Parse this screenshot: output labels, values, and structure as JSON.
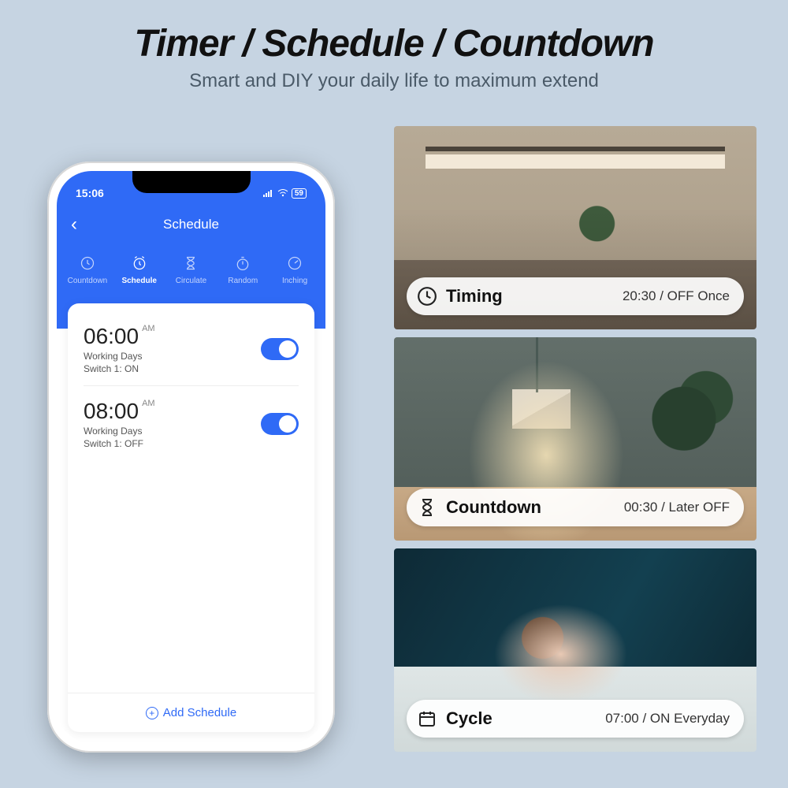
{
  "heading": {
    "title": "Timer / Schedule / Countdown",
    "subtitle": "Smart and DIY your daily life to maximum extend"
  },
  "phone": {
    "status_time": "15:06",
    "battery": "59",
    "page_title": "Schedule",
    "tabs": [
      {
        "label": "Countdown"
      },
      {
        "label": "Schedule"
      },
      {
        "label": "Circulate"
      },
      {
        "label": "Random"
      },
      {
        "label": "Inching"
      }
    ],
    "schedules": [
      {
        "time": "06:00",
        "ampm": "AM",
        "days": "Working Days",
        "switch": "Switch 1: ON"
      },
      {
        "time": "08:00",
        "ampm": "AM",
        "days": "Working Days",
        "switch": "Switch 1: OFF"
      }
    ],
    "add_label": "Add Schedule"
  },
  "features": [
    {
      "label": "Timing",
      "value": "20:30 / OFF Once"
    },
    {
      "label": "Countdown",
      "value": "00:30 / Later OFF"
    },
    {
      "label": "Cycle",
      "value": "07:00 / ON Everyday"
    }
  ]
}
